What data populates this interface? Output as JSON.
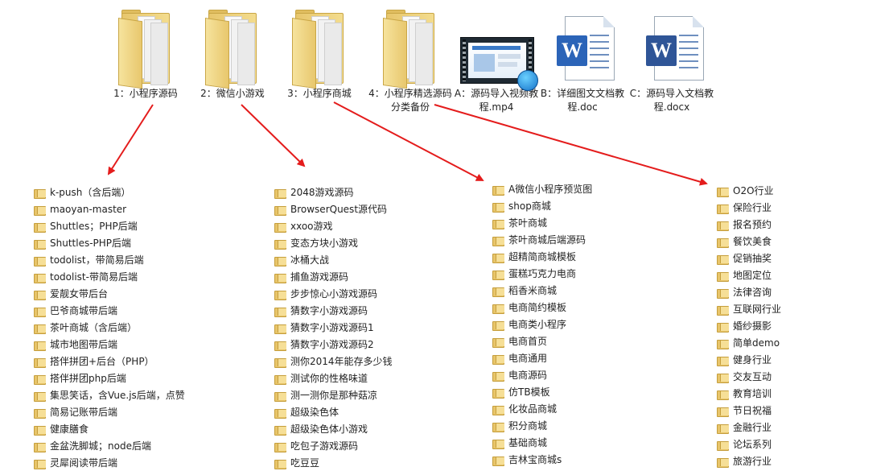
{
  "top_items": [
    {
      "label": "1：小程序源码",
      "icon": "folder-icon"
    },
    {
      "label": "2：微信小游戏",
      "icon": "folder-icon"
    },
    {
      "label": "3：小程序商城",
      "icon": "folder-icon"
    },
    {
      "label": "4：小程序精选源码分类备份",
      "icon": "folder-icon"
    },
    {
      "label": "A：源码导入视频教程.mp4",
      "icon": "video-file-icon"
    },
    {
      "label": "B：详细图文文档教程.doc",
      "icon": "word-doc-icon",
      "badge": "W"
    },
    {
      "label": "C：源码导入文档教程.docx",
      "icon": "word-docx-icon",
      "badge": "W"
    }
  ],
  "columns": [
    {
      "name": "小程序源码",
      "items": [
        "k-push（含后端）",
        "maoyan-master",
        "Shuttles；PHP后端",
        "Shuttles-PHP后端",
        "todolist，带简易后端",
        "todolist-带简易后端",
        "爱靓女带后台",
        "巴爷商城带后端",
        "茶叶商城（含后端）",
        "城市地图带后端",
        "搭伴拼团+后台（PHP）",
        "搭伴拼团php后端",
        "集思笑话，含Vue.js后端，点赞",
        "简易记账带后端",
        "健康膳食",
        "金盆洗脚城；node后端",
        "灵犀阅读带后端"
      ]
    },
    {
      "name": "微信小游戏",
      "items": [
        "2048游戏源码",
        "BrowserQuest源代码",
        "xxoo游戏",
        "变态方块小游戏",
        "冰桶大战",
        "捕鱼游戏源码",
        "步步惊心小游戏源码",
        "猜数字小游戏源码",
        "猜数字小游戏源码1",
        "猜数字小游戏源码2",
        "测你2014年能存多少钱",
        "测试你的性格味道",
        "测一测你是那种菇凉",
        "超级染色体",
        "超级染色体小游戏",
        "吃包子游戏源码",
        "吃豆豆"
      ]
    },
    {
      "name": "小程序商城",
      "items": [
        "A微信小程序预览图",
        "shop商城",
        "茶叶商城",
        "茶叶商城后端源码",
        "超精简商城模板",
        "蛋糕巧克力电商",
        "稻香米商城",
        "电商简约模板",
        "电商类小程序",
        "电商首页",
        "电商通用",
        "电商源码",
        "仿TB模板",
        "化妆品商城",
        "积分商城",
        "基础商城",
        "吉林宝商城s"
      ]
    },
    {
      "name": "小程序精选源码分类备份",
      "items": [
        "O2O行业",
        "保险行业",
        "报名预约",
        "餐饮美食",
        "促销抽奖",
        "地图定位",
        "法律咨询",
        "互联网行业",
        "婚纱摄影",
        "简单demo",
        "健身行业",
        "交友互动",
        "教育培训",
        "节日祝福",
        "金融行业",
        "论坛系列",
        "旅游行业"
      ]
    }
  ],
  "colors": {
    "arrow": "#e41c1c",
    "folder": "#e8c56a"
  }
}
